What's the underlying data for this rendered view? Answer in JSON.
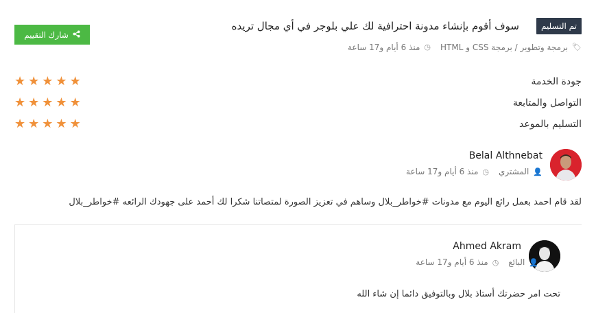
{
  "header": {
    "status_badge": "تم التسليم",
    "title": "سوف أقوم بإنشاء مدونة احترافية لك علي بلوجر في أي مجال تريده",
    "category": "برمجة وتطوير / برمجة CSS و HTML",
    "time_ago": "منذ 6 أيام و17 ساعة",
    "share_label": "شارك التقييم"
  },
  "ratings": [
    {
      "label": "جودة الخدمة",
      "stars": 5
    },
    {
      "label": "التواصل والمتابعة",
      "stars": 5
    },
    {
      "label": "التسليم بالموعد",
      "stars": 5
    }
  ],
  "reviews": [
    {
      "name": "Belal Althnebat",
      "role": "المشتري",
      "time_ago": "منذ 6 أيام و17 ساعة",
      "text": "لقد قام احمد بعمل رائع اليوم مع مدونات #خواطر_بلال وساهم في تعزيز الصورة لمتصاتنا شكرا لك أحمد على جهودك الرائعه #خواطر_بلال"
    },
    {
      "name": "Ahmed Akram",
      "role": "البائع",
      "time_ago": "منذ 6 أيام و17 ساعة",
      "text": "تحت امر حضرتك أستاذ بلال وبالتوفيق دائما إن شاء الله"
    }
  ],
  "colors": {
    "badge_bg": "#2f3a4a",
    "share_button": "#4cb944",
    "star": "#f0913a"
  }
}
